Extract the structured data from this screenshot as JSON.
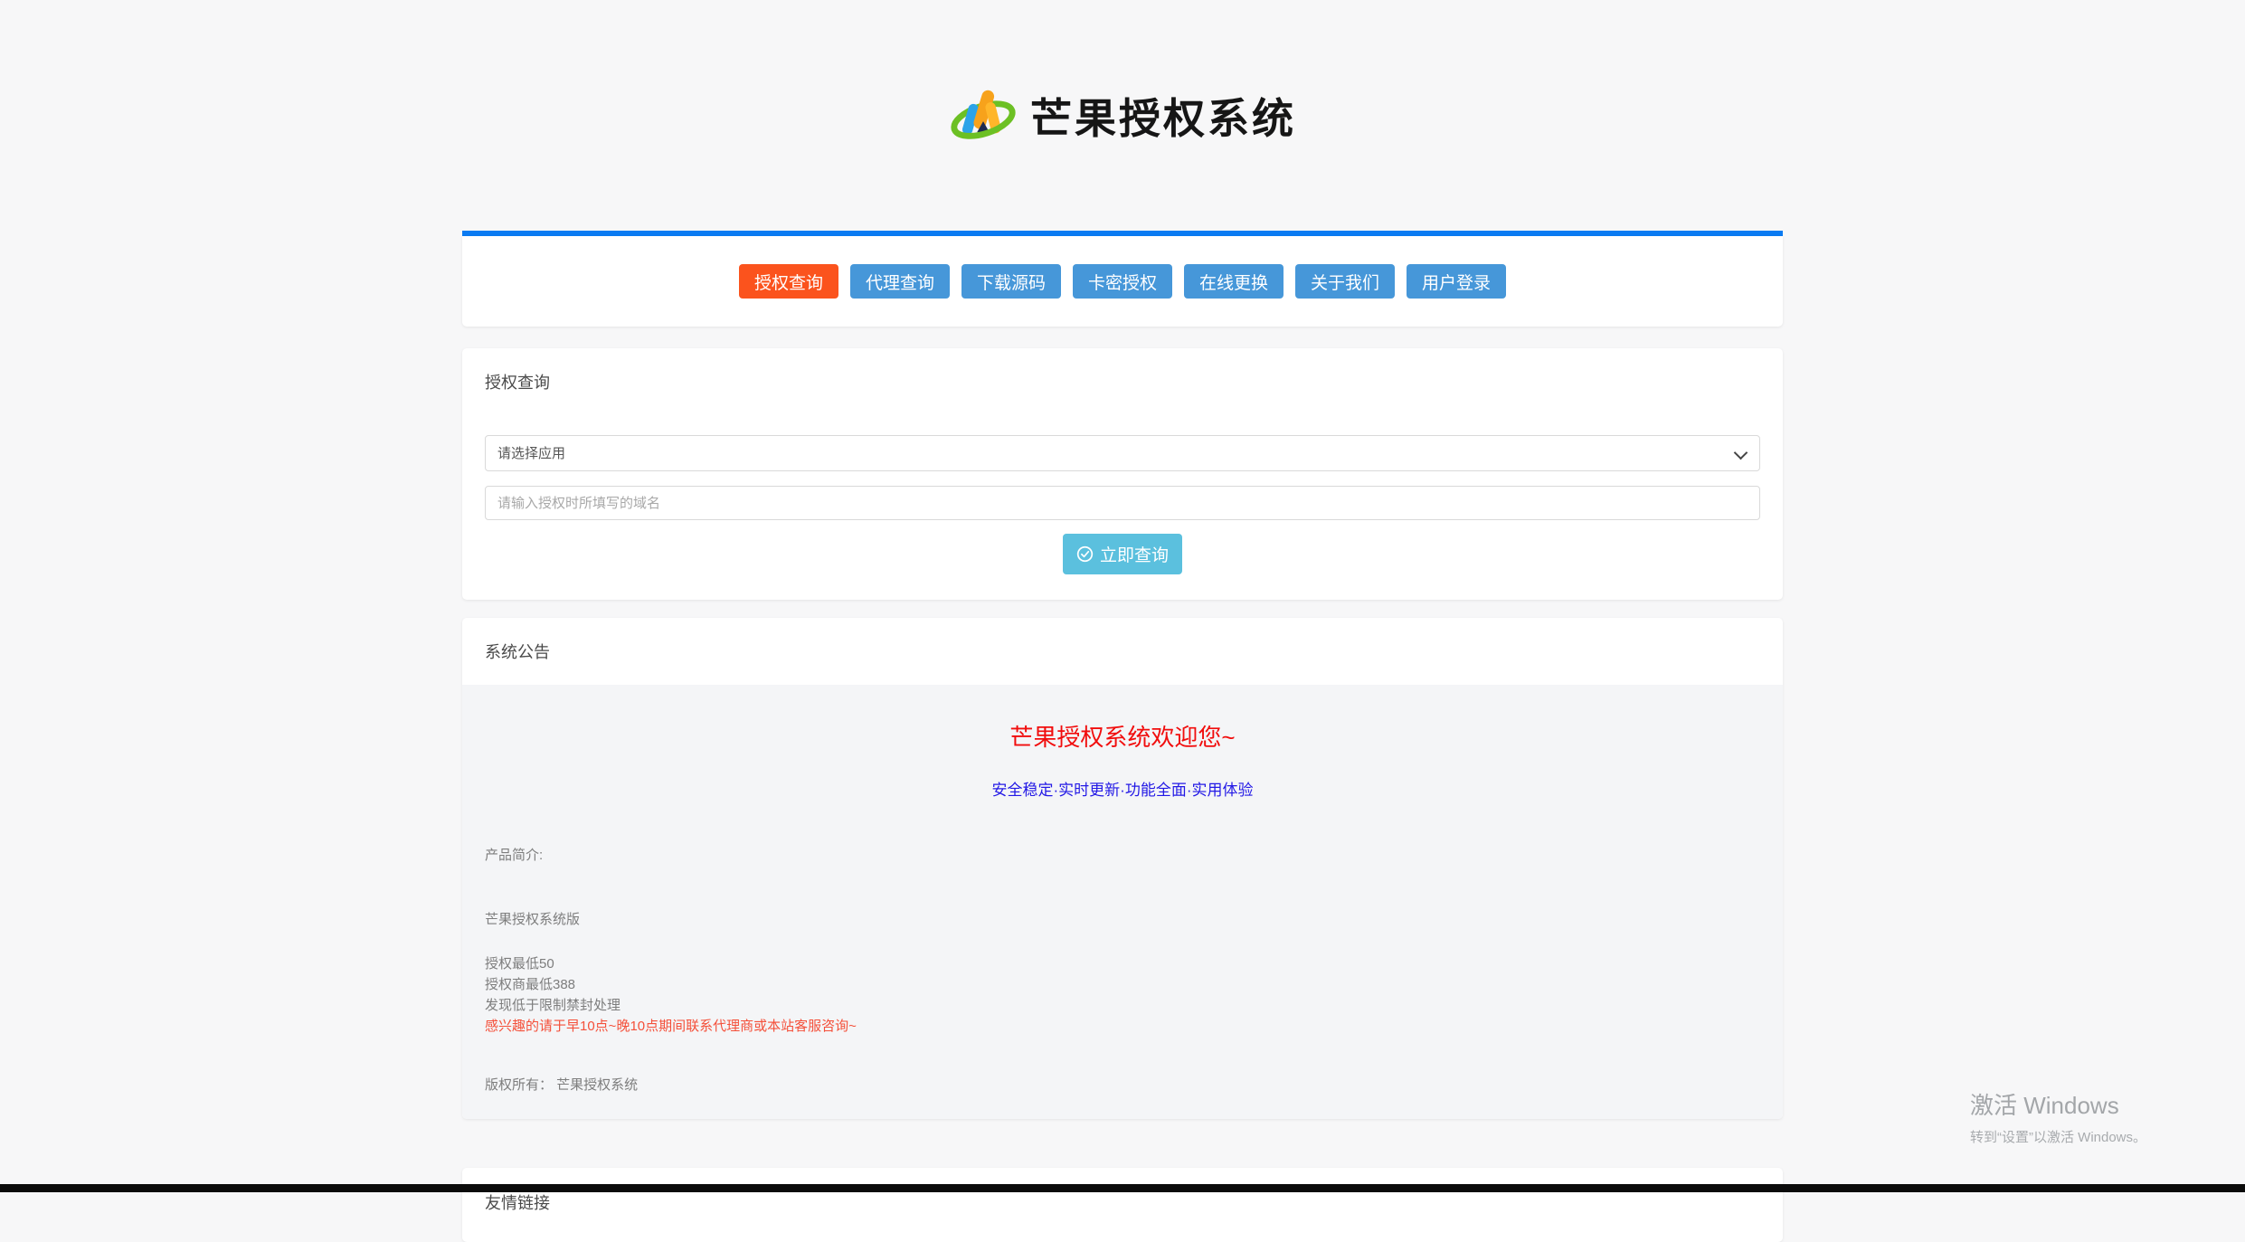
{
  "brand": {
    "title": "芒果授权系统",
    "logo_icon": "mango-logo-icon"
  },
  "nav": {
    "items": [
      {
        "label": "授权查询",
        "active": true
      },
      {
        "label": "代理查询",
        "active": false
      },
      {
        "label": "下载源码",
        "active": false
      },
      {
        "label": "卡密授权",
        "active": false
      },
      {
        "label": "在线更换",
        "active": false
      },
      {
        "label": "关于我们",
        "active": false
      },
      {
        "label": "用户登录",
        "active": false
      }
    ]
  },
  "query_card": {
    "title": "授权查询",
    "app_select": {
      "value": "请选择应用"
    },
    "domain_input": {
      "placeholder": "请输入授权时所填写的域名"
    },
    "submit": {
      "label": "立即查询",
      "icon": "check-circle-icon"
    }
  },
  "notice_card": {
    "title": "系统公告",
    "headline": "芒果授权系统欢迎您~",
    "subline": "安全稳定·实时更新·功能全面·实用体验",
    "intro_label": "产品简介:",
    "product_name": "芒果授权系统版",
    "line1": "授权最低50",
    "line2": "授权商最低388",
    "line3": "发现低于限制禁封处理",
    "contact_line": "感兴趣的请于早10点~晚10点期间联系代理商或本站客服咨询~",
    "copyright_line": "版权所有： 芒果授权系统"
  },
  "links_card": {
    "title": "友情链接"
  },
  "watermark": {
    "line1": "激活 Windows",
    "line2": "转到“设置”以激活 Windows。"
  },
  "colors": {
    "accent_blue": "#0a7bf2",
    "nav_blue": "#4697d9",
    "nav_active_orange": "#fb531d",
    "submit_cyan": "#5bc0de",
    "headline_red": "#f10d0d",
    "subline_blue": "#2319e6",
    "notice_red": "#f4503a",
    "page_background": "#f7f7f8",
    "notice_body_background": "#f4f5f7"
  }
}
